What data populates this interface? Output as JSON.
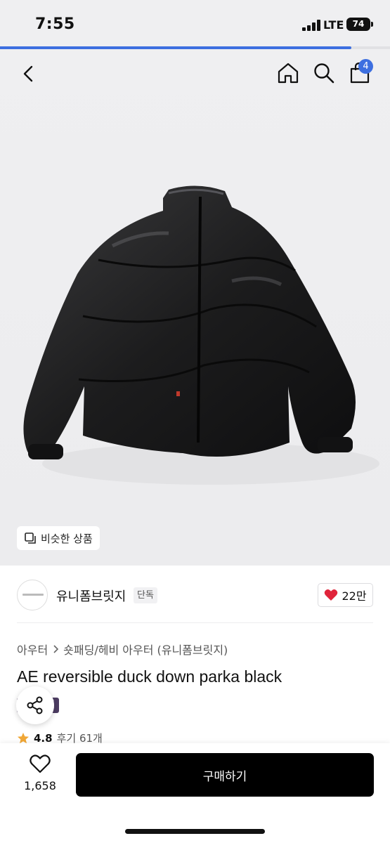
{
  "status_bar": {
    "time": "7:55",
    "network": "LTE",
    "battery": "74"
  },
  "page_progress": 0.9,
  "header": {
    "back_icon": "chevron-left-icon",
    "home_icon": "home-icon",
    "search_icon": "search-icon",
    "cart_icon": "shopping-bag-icon",
    "cart_count": "4"
  },
  "hero": {
    "similar_label": "비슷한 상품",
    "similar_icon": "copy-icon"
  },
  "brand": {
    "name": "유니폼브릿지",
    "tag": "단독",
    "likes": "22만",
    "like_icon": "heart-filled-icon"
  },
  "breadcrumb": {
    "category": "아우터",
    "subcategory": "숏패딩/헤비 아우터 (유니폼브릿지)"
  },
  "product": {
    "title": "AE reversible duck down parka black",
    "badge": "세일",
    "rating": "4.8",
    "reviews": "후기 61개"
  },
  "bottom_bar": {
    "wish_count": "1,658",
    "buy_label": "구매하기"
  },
  "colors": {
    "accent": "#3d6fe0",
    "heart": "#e0243a",
    "star": "#f0a736",
    "sale": "#4c3c62",
    "buy": "#000000"
  }
}
